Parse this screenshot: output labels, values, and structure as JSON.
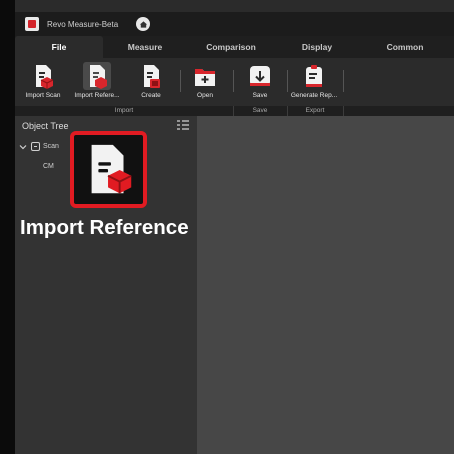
{
  "app": {
    "title": "Revo Measure-Beta"
  },
  "tabs": [
    {
      "label": "File"
    },
    {
      "label": "Measure"
    },
    {
      "label": "Comparison"
    },
    {
      "label": "Display"
    },
    {
      "label": "Common"
    }
  ],
  "ribbon": {
    "buttons": [
      {
        "label": "Import Scan",
        "icon": "import-scan-icon"
      },
      {
        "label": "Import Refere...",
        "icon": "import-reference-icon"
      },
      {
        "label": "Create",
        "icon": "create-icon"
      },
      {
        "label": "Open",
        "icon": "open-icon"
      },
      {
        "label": "Save",
        "icon": "save-icon"
      },
      {
        "label": "Generate Rep...",
        "icon": "generate-report-icon"
      }
    ],
    "groups": [
      {
        "label": "Import"
      },
      {
        "label": "Save"
      },
      {
        "label": "Export"
      }
    ]
  },
  "object_tree": {
    "title": "Object Tree",
    "root_label": "Scan",
    "child_label": "CM"
  },
  "callout": {
    "label": "Import Reference"
  },
  "colors": {
    "accent": "#e11b22",
    "panel": "#333333",
    "viewport": "#474747"
  }
}
